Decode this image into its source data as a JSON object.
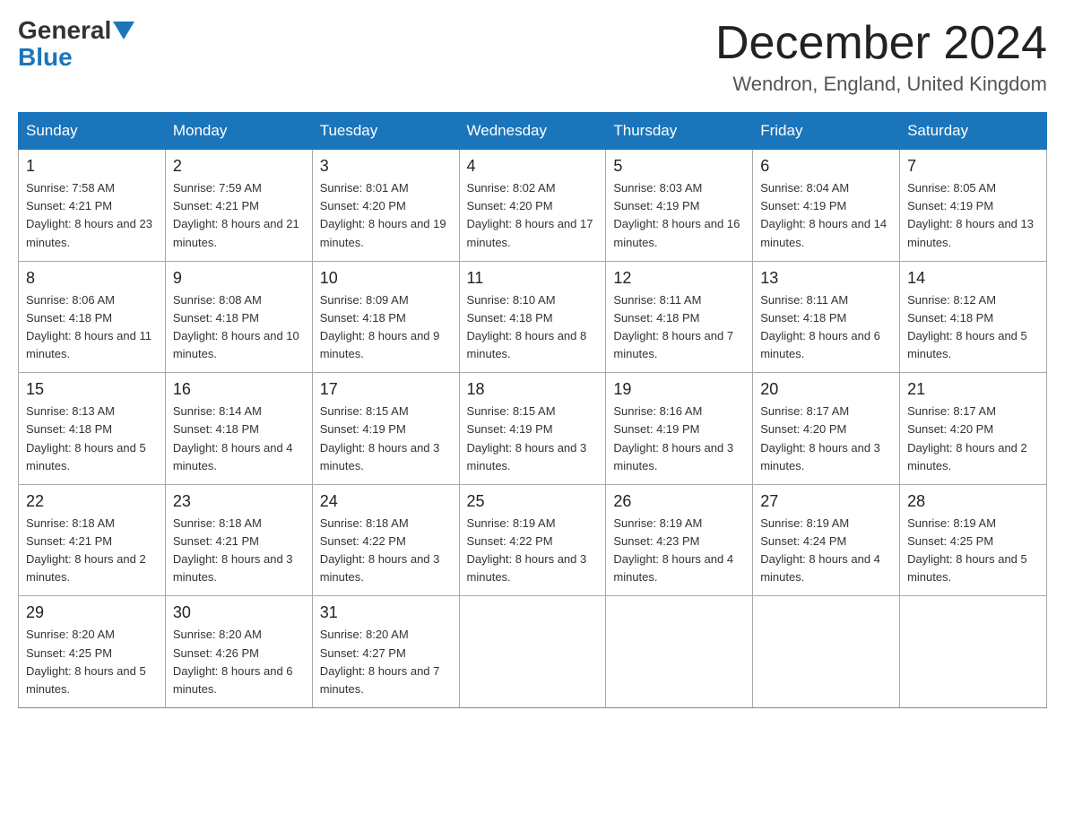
{
  "header": {
    "logo_general": "General",
    "logo_blue": "Blue",
    "month_title": "December 2024",
    "subtitle": "Wendron, England, United Kingdom"
  },
  "days_of_week": [
    "Sunday",
    "Monday",
    "Tuesday",
    "Wednesday",
    "Thursday",
    "Friday",
    "Saturday"
  ],
  "weeks": [
    [
      {
        "day": "1",
        "sunrise": "7:58 AM",
        "sunset": "4:21 PM",
        "daylight": "8 hours and 23 minutes."
      },
      {
        "day": "2",
        "sunrise": "7:59 AM",
        "sunset": "4:21 PM",
        "daylight": "8 hours and 21 minutes."
      },
      {
        "day": "3",
        "sunrise": "8:01 AM",
        "sunset": "4:20 PM",
        "daylight": "8 hours and 19 minutes."
      },
      {
        "day": "4",
        "sunrise": "8:02 AM",
        "sunset": "4:20 PM",
        "daylight": "8 hours and 17 minutes."
      },
      {
        "day": "5",
        "sunrise": "8:03 AM",
        "sunset": "4:19 PM",
        "daylight": "8 hours and 16 minutes."
      },
      {
        "day": "6",
        "sunrise": "8:04 AM",
        "sunset": "4:19 PM",
        "daylight": "8 hours and 14 minutes."
      },
      {
        "day": "7",
        "sunrise": "8:05 AM",
        "sunset": "4:19 PM",
        "daylight": "8 hours and 13 minutes."
      }
    ],
    [
      {
        "day": "8",
        "sunrise": "8:06 AM",
        "sunset": "4:18 PM",
        "daylight": "8 hours and 11 minutes."
      },
      {
        "day": "9",
        "sunrise": "8:08 AM",
        "sunset": "4:18 PM",
        "daylight": "8 hours and 10 minutes."
      },
      {
        "day": "10",
        "sunrise": "8:09 AM",
        "sunset": "4:18 PM",
        "daylight": "8 hours and 9 minutes."
      },
      {
        "day": "11",
        "sunrise": "8:10 AM",
        "sunset": "4:18 PM",
        "daylight": "8 hours and 8 minutes."
      },
      {
        "day": "12",
        "sunrise": "8:11 AM",
        "sunset": "4:18 PM",
        "daylight": "8 hours and 7 minutes."
      },
      {
        "day": "13",
        "sunrise": "8:11 AM",
        "sunset": "4:18 PM",
        "daylight": "8 hours and 6 minutes."
      },
      {
        "day": "14",
        "sunrise": "8:12 AM",
        "sunset": "4:18 PM",
        "daylight": "8 hours and 5 minutes."
      }
    ],
    [
      {
        "day": "15",
        "sunrise": "8:13 AM",
        "sunset": "4:18 PM",
        "daylight": "8 hours and 5 minutes."
      },
      {
        "day": "16",
        "sunrise": "8:14 AM",
        "sunset": "4:18 PM",
        "daylight": "8 hours and 4 minutes."
      },
      {
        "day": "17",
        "sunrise": "8:15 AM",
        "sunset": "4:19 PM",
        "daylight": "8 hours and 3 minutes."
      },
      {
        "day": "18",
        "sunrise": "8:15 AM",
        "sunset": "4:19 PM",
        "daylight": "8 hours and 3 minutes."
      },
      {
        "day": "19",
        "sunrise": "8:16 AM",
        "sunset": "4:19 PM",
        "daylight": "8 hours and 3 minutes."
      },
      {
        "day": "20",
        "sunrise": "8:17 AM",
        "sunset": "4:20 PM",
        "daylight": "8 hours and 3 minutes."
      },
      {
        "day": "21",
        "sunrise": "8:17 AM",
        "sunset": "4:20 PM",
        "daylight": "8 hours and 2 minutes."
      }
    ],
    [
      {
        "day": "22",
        "sunrise": "8:18 AM",
        "sunset": "4:21 PM",
        "daylight": "8 hours and 2 minutes."
      },
      {
        "day": "23",
        "sunrise": "8:18 AM",
        "sunset": "4:21 PM",
        "daylight": "8 hours and 3 minutes."
      },
      {
        "day": "24",
        "sunrise": "8:18 AM",
        "sunset": "4:22 PM",
        "daylight": "8 hours and 3 minutes."
      },
      {
        "day": "25",
        "sunrise": "8:19 AM",
        "sunset": "4:22 PM",
        "daylight": "8 hours and 3 minutes."
      },
      {
        "day": "26",
        "sunrise": "8:19 AM",
        "sunset": "4:23 PM",
        "daylight": "8 hours and 4 minutes."
      },
      {
        "day": "27",
        "sunrise": "8:19 AM",
        "sunset": "4:24 PM",
        "daylight": "8 hours and 4 minutes."
      },
      {
        "day": "28",
        "sunrise": "8:19 AM",
        "sunset": "4:25 PM",
        "daylight": "8 hours and 5 minutes."
      }
    ],
    [
      {
        "day": "29",
        "sunrise": "8:20 AM",
        "sunset": "4:25 PM",
        "daylight": "8 hours and 5 minutes."
      },
      {
        "day": "30",
        "sunrise": "8:20 AM",
        "sunset": "4:26 PM",
        "daylight": "8 hours and 6 minutes."
      },
      {
        "day": "31",
        "sunrise": "8:20 AM",
        "sunset": "4:27 PM",
        "daylight": "8 hours and 7 minutes."
      },
      null,
      null,
      null,
      null
    ]
  ]
}
